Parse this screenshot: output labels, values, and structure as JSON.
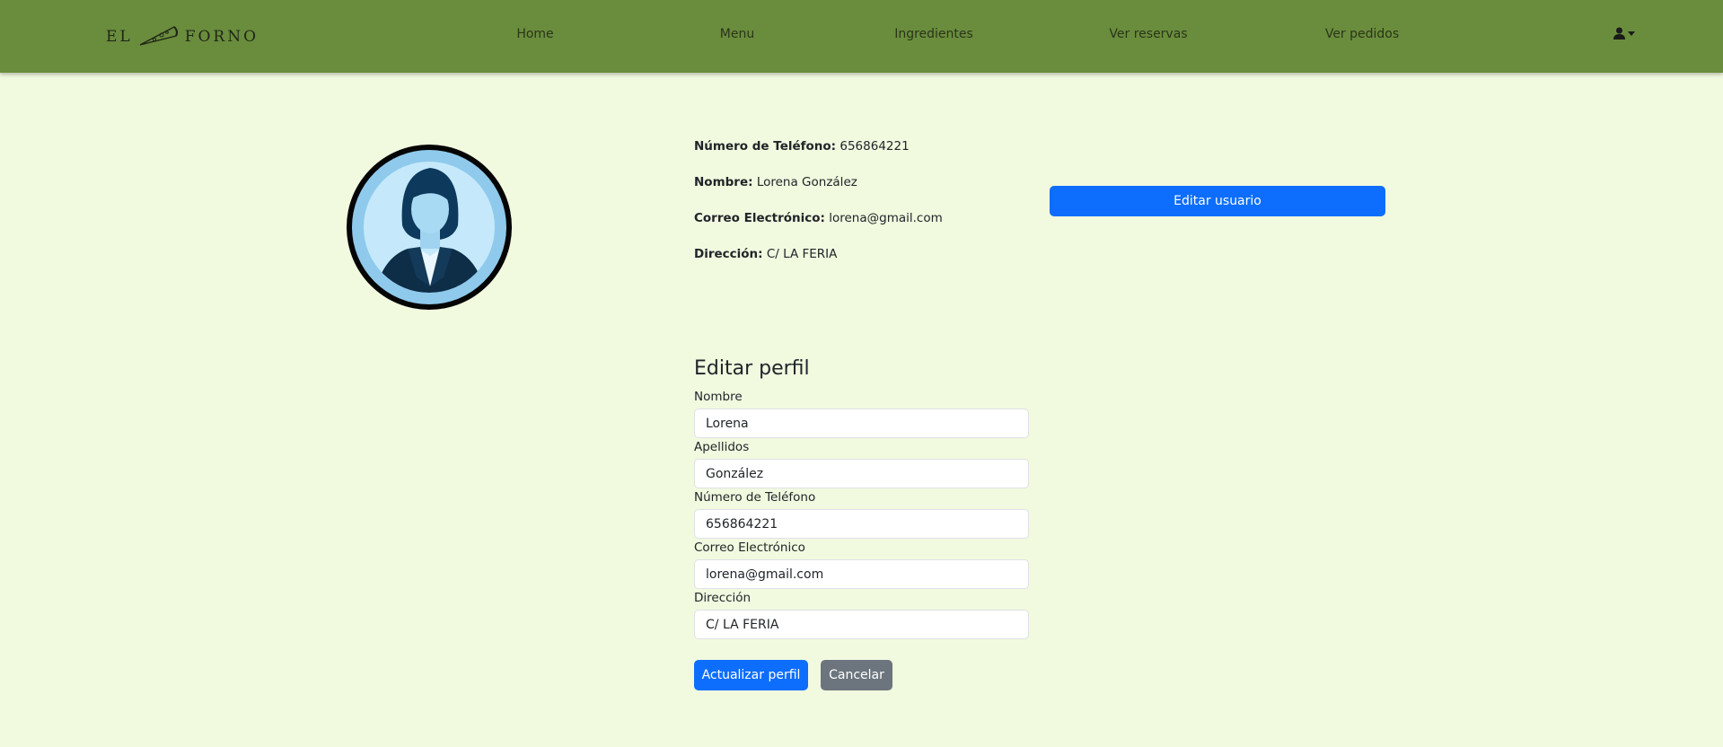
{
  "brand": {
    "left": "EL",
    "right": "FORNO"
  },
  "nav": {
    "items": [
      {
        "label": "Home"
      },
      {
        "label": "Menu"
      },
      {
        "label": "Ingredientes"
      },
      {
        "label": "Ver reservas"
      },
      {
        "label": "Ver pedidos"
      }
    ]
  },
  "profile": {
    "phone": {
      "label": "Número de Teléfono:",
      "value": "656864221"
    },
    "name": {
      "label": "Nombre:",
      "value": "Lorena González"
    },
    "email": {
      "label": "Correo Electrónico:",
      "value": "lorena@gmail.com"
    },
    "address": {
      "label": "Dirección:",
      "value": "C/ LA FERIA"
    },
    "edit_user_button": "Editar usuario"
  },
  "form": {
    "title": "Editar perfil",
    "fields": [
      {
        "label": "Nombre",
        "value": "Lorena"
      },
      {
        "label": "Apellidos",
        "value": "González"
      },
      {
        "label": "Número de Teléfono",
        "value": "656864221"
      },
      {
        "label": "Correo Electrónico",
        "value": "lorena@gmail.com"
      },
      {
        "label": "Dirección",
        "value": "C/ LA FERIA"
      }
    ],
    "submit_label": "Actualizar perfil",
    "cancel_label": "Cancelar"
  },
  "colors": {
    "navbar": "#6a8d3d",
    "background": "#f1f9df",
    "primary": "#0d6efd",
    "secondary": "#6c757d"
  }
}
